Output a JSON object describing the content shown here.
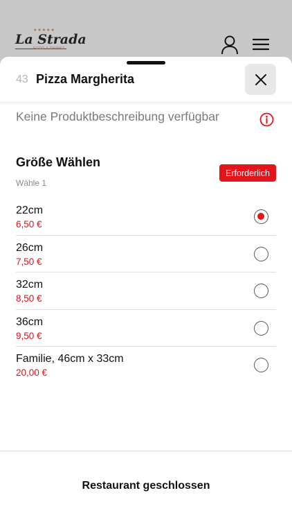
{
  "brand": {
    "name": "La Strada",
    "stars": "★★★★★",
    "tagline": "FOOD & DRINKS"
  },
  "product": {
    "number": "43",
    "title": "Pizza Margherita",
    "description": "Keine Produktbeschreibung verfügbar"
  },
  "group": {
    "title": "Größe Wählen",
    "subtitle": "Wähle 1",
    "badge": "Erforderlich"
  },
  "options": [
    {
      "label": "22cm",
      "price": "6,50 €",
      "selected": true
    },
    {
      "label": "26cm",
      "price": "7,50 €",
      "selected": false
    },
    {
      "label": "32cm",
      "price": "8,50 €",
      "selected": false
    },
    {
      "label": "36cm",
      "price": "9,50 €",
      "selected": false
    },
    {
      "label": "Familie, 46cm x 33cm",
      "price": "20,00 €",
      "selected": false
    }
  ],
  "footer": {
    "status": "Restaurant geschlossen"
  },
  "icons": {
    "user": "user-icon",
    "menu": "hamburger-menu-icon",
    "close": "close-icon",
    "info": "info-icon"
  },
  "colors": {
    "accent": "#e4141b",
    "price": "#d8141a"
  }
}
